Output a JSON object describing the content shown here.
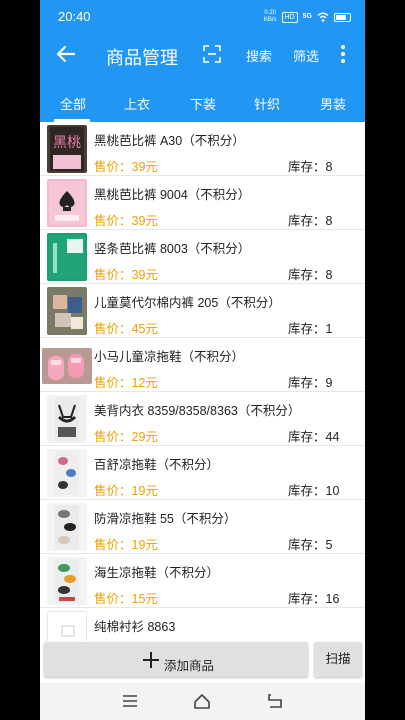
{
  "status_bar": {
    "time": "20:40",
    "net_speed_value": "0.20",
    "net_speed_unit": "KB/s",
    "hd": "HD",
    "signal": "5G"
  },
  "app_bar": {
    "title": "商品管理",
    "search_label": "搜索",
    "filter_label": "筛选"
  },
  "tabs": [
    {
      "label": "全部",
      "active": true
    },
    {
      "label": "上衣",
      "active": false
    },
    {
      "label": "下装",
      "active": false
    },
    {
      "label": "针织",
      "active": false
    },
    {
      "label": "男装",
      "active": false
    }
  ],
  "products": [
    {
      "name": "黑桃芭比裤 A30（不积分）",
      "price": "售价：39元",
      "stock": "库存：8",
      "thumb_text": "黑桃"
    },
    {
      "name": "黑桃芭比裤 9004（不积分）",
      "price": "售价：39元",
      "stock": "库存：8"
    },
    {
      "name": "竖条芭比裤 8003（不积分）",
      "price": "售价：39元",
      "stock": "库存：8"
    },
    {
      "name": "儿童莫代尔棉内裤 205（不积分）",
      "price": "售价：45元",
      "stock": "库存：1"
    },
    {
      "name": "小马儿童凉拖鞋（不积分）",
      "price": "售价：12元",
      "stock": "库存：9"
    },
    {
      "name": "美背内衣 8359/8358/8363（不积分）",
      "price": "售价：29元",
      "stock": "库存：44"
    },
    {
      "name": "百舒凉拖鞋（不积分）",
      "price": "售价：19元",
      "stock": "库存：10"
    },
    {
      "name": "防滑凉拖鞋 55（不积分）",
      "price": "售价：19元",
      "stock": "库存：5"
    },
    {
      "name": "海生凉拖鞋（不积分）",
      "price": "售价：15元",
      "stock": "库存：16"
    },
    {
      "name": "纯棉衬衫 8863",
      "price": "",
      "stock": ""
    }
  ],
  "bottom": {
    "add_label": "添加商品",
    "scan_label": "扫描"
  },
  "colors": {
    "primary": "#2196f3",
    "price": "#f0a000"
  },
  "icons": [
    "back-arrow-icon",
    "scan-frame-icon",
    "more-vert-icon",
    "plus-icon",
    "nav-menu-icon",
    "nav-home-icon",
    "nav-back-icon"
  ]
}
